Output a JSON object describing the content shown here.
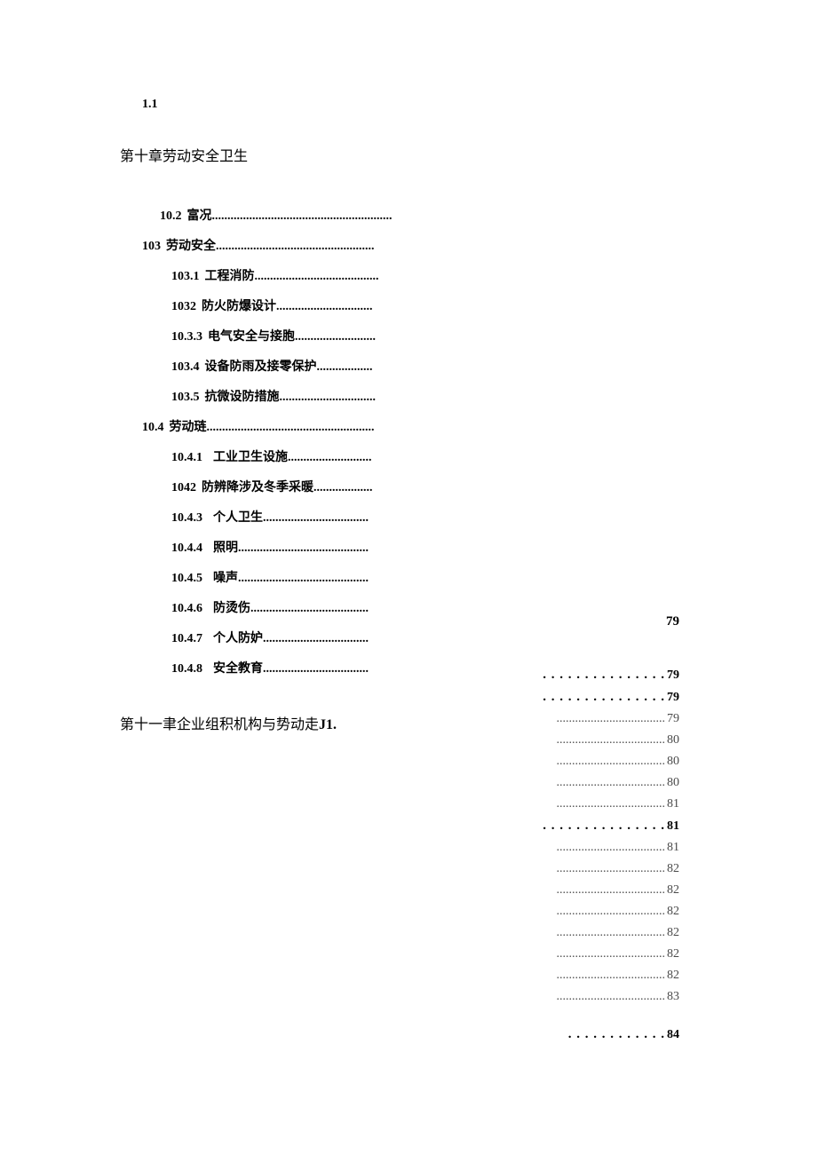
{
  "header_num": "1.1",
  "chapter10_title": "第十章劳动安全卫生",
  "toc": [
    {
      "num": "10.2",
      "label": "富况",
      "dots": "..........................................................",
      "bold": true,
      "indent": "indent-0",
      "gap": "gap"
    },
    {
      "num": "103",
      "label": "劳动安全",
      "dots": "...................................................",
      "bold": true,
      "indent": "indent-neg",
      "gap": "gap"
    },
    {
      "num": "103.1",
      "label": "工程消防",
      "dots": "........................................",
      "bold": true,
      "indent": "indent-1",
      "gap": "gap"
    },
    {
      "num": "1032",
      "label": "防火防爆设计",
      "dots": "...............................",
      "bold": true,
      "indent": "indent-1",
      "gap": "gap"
    },
    {
      "num": "10.3.3",
      "label": "电气安全与接胞",
      "dots": "..........................",
      "bold": true,
      "indent": "indent-1",
      "gap": "gap"
    },
    {
      "num": "103.4",
      "label": "设备防雨及接零保护",
      "dots": "..................",
      "bold": true,
      "indent": "indent-1",
      "gap": "gap"
    },
    {
      "num": "103.5",
      "label": "抗微设防措施",
      "dots": "...............................",
      "bold": true,
      "indent": "indent-1",
      "gap": "gap"
    },
    {
      "num": "10.4",
      "label": "劳动琏",
      "dots": "......................................................",
      "bold": true,
      "indent": "indent-neg",
      "gap": "gap"
    },
    {
      "num": "10.4.1",
      "label": "工业卫生设施",
      "dots": "...........................",
      "bold": true,
      "indent": "indent-1",
      "gap": "gap2"
    },
    {
      "num": "1042",
      "label": "防辨降涉及冬季采暖",
      "dots": "...................",
      "bold": true,
      "indent": "indent-1",
      "gap": "gap"
    },
    {
      "num": "10.4.3",
      "label": "个人卫生",
      "dots": "..................................",
      "bold": true,
      "indent": "indent-1",
      "gap": "gap2"
    },
    {
      "num": "10.4.4",
      "label": "照明",
      "dots": "..........................................",
      "bold": true,
      "indent": "indent-1",
      "gap": "gap2"
    },
    {
      "num": "10.4.5",
      "label": "噪声",
      "dots": "..........................................",
      "bold": true,
      "indent": "indent-1",
      "gap": "gap2"
    },
    {
      "num": "10.4.6",
      "label": "防烫伤",
      "dots": "......................................",
      "bold": true,
      "indent": "indent-1",
      "gap": "gap2"
    },
    {
      "num": "10.4.7",
      "label": "个人防妒",
      "dots": "..................................",
      "bold": true,
      "indent": "indent-1",
      "gap": "gap2"
    },
    {
      "num": "10.4.8",
      "label": "安全教育",
      "dots": "..................................",
      "bold": true,
      "indent": "indent-1",
      "gap": "gap2"
    }
  ],
  "chapter11_prefix": "第十一聿企业组积机构与势动走",
  "chapter11_j1": "J1.",
  "page_79_top": "79",
  "right_lines": [
    {
      "dots": ". . . . . . . . . . . . . . .",
      "pg": "79",
      "cls": "bold bigdots"
    },
    {
      "dots": ". . . . . . . . . . . . . . .",
      "pg": "79",
      "cls": "bold bigdots"
    },
    {
      "dots": "...................................",
      "pg": "79",
      "cls": ""
    },
    {
      "dots": "...................................",
      "pg": "80",
      "cls": ""
    },
    {
      "dots": "...................................",
      "pg": "80",
      "cls": ""
    },
    {
      "dots": "...................................",
      "pg": "80",
      "cls": ""
    },
    {
      "dots": "...................................",
      "pg": "81",
      "cls": ""
    },
    {
      "dots": ". . . . . . . . . . . . . . .",
      "pg": "81",
      "cls": "bold bigdots"
    },
    {
      "dots": "...................................",
      "pg": "81",
      "cls": ""
    },
    {
      "dots": "...................................",
      "pg": "82",
      "cls": ""
    },
    {
      "dots": "...................................",
      "pg": "82",
      "cls": ""
    },
    {
      "dots": "...................................",
      "pg": "82",
      "cls": ""
    },
    {
      "dots": "...................................",
      "pg": "82",
      "cls": ""
    },
    {
      "dots": "...................................",
      "pg": "82",
      "cls": ""
    },
    {
      "dots": "...................................",
      "pg": "82",
      "cls": ""
    },
    {
      "dots": "...................................",
      "pg": "83",
      "cls": ""
    },
    {
      "dots": ". . . . . . . . . . . .",
      "pg": "84",
      "cls": "bold bigdots last"
    }
  ]
}
